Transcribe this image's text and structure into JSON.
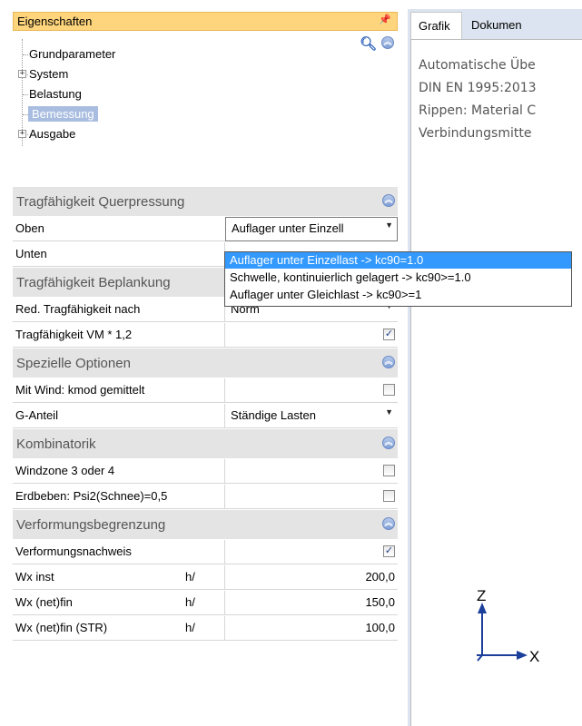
{
  "panel": {
    "title": "Eigenschaften",
    "pin": "ᵖ"
  },
  "tree": {
    "items": [
      {
        "label": "Grundparameter",
        "expander": ""
      },
      {
        "label": "System",
        "expander": "+"
      },
      {
        "label": "Belastung",
        "expander": ""
      },
      {
        "label": "Bemessung",
        "expander": "",
        "selected": true
      },
      {
        "label": "Ausgabe",
        "expander": "+"
      }
    ]
  },
  "sections": {
    "querpressung": {
      "title": "Tragfähigkeit Querpressung"
    },
    "beplankung": {
      "title": "Tragfähigkeit Beplankung"
    },
    "optionen": {
      "title": "Spezielle Optionen"
    },
    "kombinatorik": {
      "title": "Kombinatorik"
    },
    "verformung": {
      "title": "Verformungsbegrenzung"
    }
  },
  "rows": {
    "oben": {
      "label": "Oben",
      "value": "Auflager unter Einzell"
    },
    "unten": {
      "label": "Unten"
    },
    "red_tragfaehigkeit": {
      "label": "Red. Tragfähigkeit nach",
      "value": "Norm"
    },
    "tragfaehigkeit_vm": {
      "label": "Tragfähigkeit VM * 1,2",
      "checked": true
    },
    "mit_wind": {
      "label": "Mit Wind: kmod gemittelt",
      "checked": false
    },
    "g_anteil": {
      "label": "G-Anteil",
      "value": "Ständige Lasten"
    },
    "windzone": {
      "label": "Windzone 3 oder 4",
      "checked": false
    },
    "erdbeben": {
      "label": "Erdbeben: Psi2(Schnee)=0,5",
      "checked": false
    },
    "verformungsnachweis": {
      "label": "Verformungsnachweis",
      "checked": true
    },
    "wx_inst": {
      "label": "Wx inst",
      "unit": "h/",
      "value": "200,0"
    },
    "wx_netfin": {
      "label": "Wx (net)fin",
      "unit": "h/",
      "value": "150,0"
    },
    "wx_netfin_str": {
      "label": "Wx (net)fin (STR)",
      "unit": "h/",
      "value": "100,0"
    }
  },
  "dropdown": {
    "options": [
      "Auflager unter Einzellast -> kc90=1.0",
      "Schwelle, kontinuierlich gelagert -> kc90>=1.0",
      "Auflager unter Gleichlast -> kc90>=1"
    ],
    "highlighted_index": 0
  },
  "tabs": [
    {
      "label": "Grafik",
      "active": true
    },
    {
      "label": "Dokumen"
    }
  ],
  "info_lines": [
    "Automatische Übe",
    "DIN EN 1995:2013",
    "Rippen: Material C",
    "Verbindungsmitte"
  ],
  "axes": {
    "z_label": "Z",
    "x_label": "X",
    "color": "#1c3f9c"
  },
  "colors": {
    "title_bar": "#fed57c",
    "selection": "#a8bde0",
    "dropdown_highlight": "#3399ff",
    "section_bg": "#e4e4e4"
  }
}
